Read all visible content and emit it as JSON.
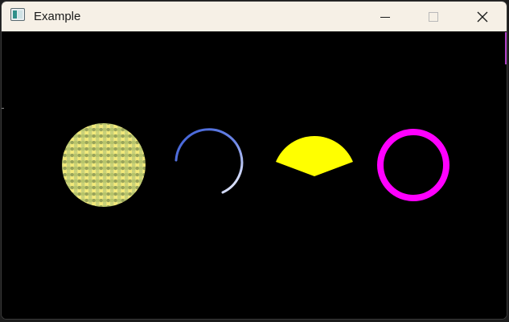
{
  "window": {
    "title": "Example"
  },
  "titlebar": {
    "icons": {
      "app": "window-app-icon",
      "minimize": "minimize-icon",
      "maximize": "maximize-icon",
      "close": "close-icon"
    }
  },
  "canvas": {
    "background": "#000000",
    "shapes": [
      {
        "name": "textured-circle",
        "kind": "filled circle with pattern",
        "colors": [
          "#f3ea7a",
          "#b7c46a",
          "#98a35a",
          "#d5d98a"
        ]
      },
      {
        "name": "gradient-arc",
        "kind": "open arc stroke",
        "colors": [
          "#3d5fd6",
          "#ffffff"
        ]
      },
      {
        "name": "yellow-pie-slice",
        "kind": "pie slice",
        "colors": [
          "#ffff00"
        ]
      },
      {
        "name": "magenta-ring",
        "kind": "circle outline",
        "colors": [
          "#ff00ff"
        ]
      }
    ]
  }
}
